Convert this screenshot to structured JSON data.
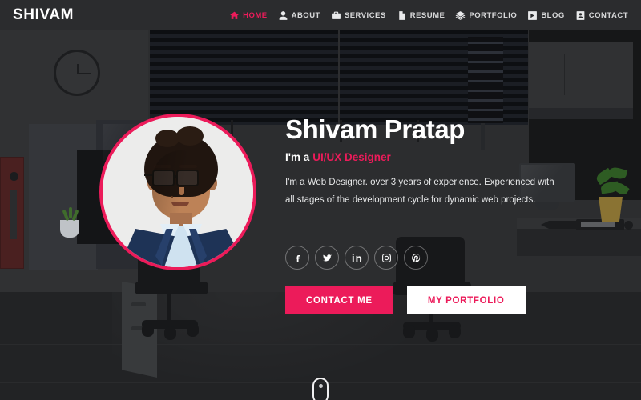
{
  "header": {
    "logo": "SHIVAM",
    "nav": [
      {
        "label": "HOME",
        "icon": "home-icon",
        "active": true
      },
      {
        "label": "ABOUT",
        "icon": "user-icon",
        "active": false
      },
      {
        "label": "SERVICES",
        "icon": "briefcase-icon",
        "active": false
      },
      {
        "label": "RESUME",
        "icon": "document-icon",
        "active": false
      },
      {
        "label": "PORTFOLIO",
        "icon": "layers-icon",
        "active": false
      },
      {
        "label": "BLOG",
        "icon": "blog-icon",
        "active": false
      },
      {
        "label": "CONTACT",
        "icon": "contact-icon",
        "active": false
      }
    ]
  },
  "hero": {
    "name": "Shivam Pratap",
    "intro_prefix": "I'm a",
    "role": "UI/UX Designer",
    "description": "I'm a Web Designer. over 3 years of experience. Experienced with all stages of the development cycle for dynamic web projects.",
    "avatar_alt": "Portrait of Shivam Pratap",
    "socials": [
      {
        "name": "facebook-icon",
        "label": "Facebook"
      },
      {
        "name": "twitter-icon",
        "label": "Twitter"
      },
      {
        "name": "linkedin-icon",
        "label": "LinkedIn"
      },
      {
        "name": "instagram-icon",
        "label": "Instagram"
      },
      {
        "name": "pinterest-icon",
        "label": "Pinterest"
      }
    ],
    "buttons": {
      "primary": "CONTACT ME",
      "secondary": "MY PORTFOLIO"
    },
    "scroll_hint": "scroll-down-indicator"
  },
  "background": {
    "scene": "office-interior-illustration",
    "clock_time": "3:00",
    "elements": [
      "wall-clock",
      "window-blinds",
      "bookshelf",
      "wall-cabinets",
      "monitor",
      "drawing-tablet",
      "potted-plant",
      "office-chair",
      "filing-cabinet",
      "door"
    ]
  },
  "colors": {
    "accent": "#ec1b5a",
    "header_bg": "#2b2c2e",
    "page_bg": "#242527",
    "text_light": "#ffffff"
  }
}
